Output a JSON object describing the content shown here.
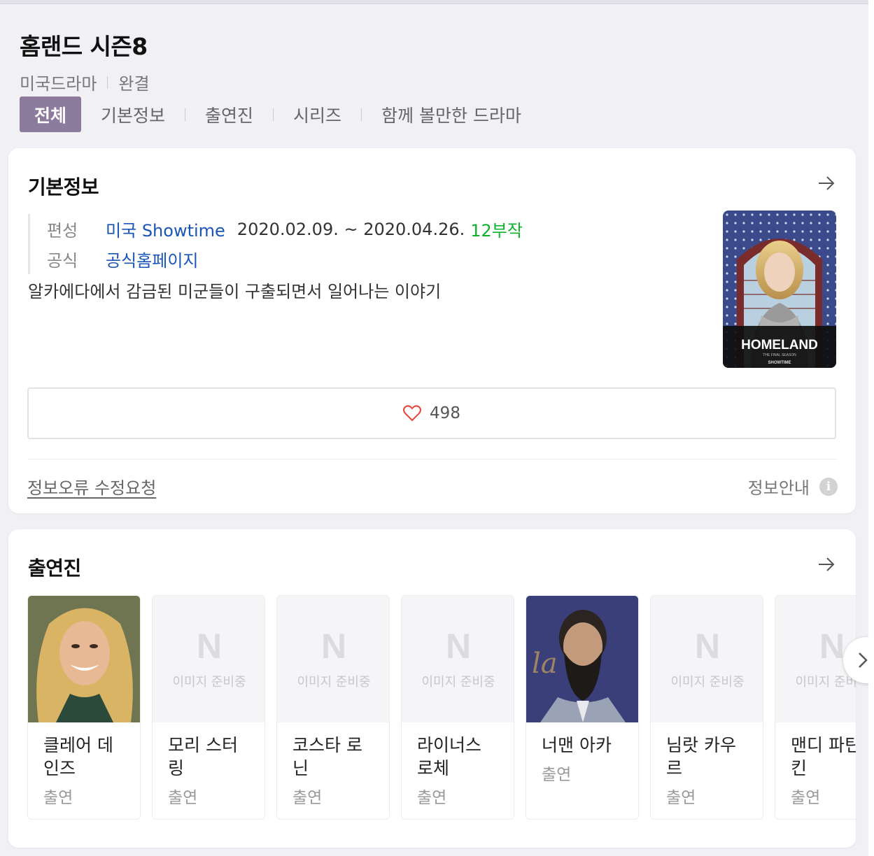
{
  "header": {
    "title": "홈랜드 시즌8",
    "genre": "미국드라마",
    "status": "완결"
  },
  "tabs": [
    {
      "label": "전체",
      "active": true
    },
    {
      "label": "기본정보"
    },
    {
      "label": "출연진"
    },
    {
      "label": "시리즈"
    },
    {
      "label": "함께 볼만한 드라마"
    }
  ],
  "basic_info": {
    "title": "기본정보",
    "broadcast_label": "편성",
    "country": "미국",
    "channel": "Showtime",
    "period": "2020.02.09. ~ 2020.04.26.",
    "episodes": "12부작",
    "official_label": "공식",
    "homepage": "공식홈페이지",
    "synopsis": "알카에다에서 감금된 미군들이 구출되면서 일어나는 이야기",
    "poster": {
      "logo": "HOMELAND",
      "tagline": "THE FINAL SEASON",
      "network": "SHOWTIME"
    },
    "like_count": "498",
    "report_link": "정보오류 수정요청",
    "info_guide": "정보안내"
  },
  "cast": {
    "title": "출연진",
    "placeholder_letter": "N",
    "placeholder_text": "이미지 준비중",
    "members": [
      {
        "name": "클레어 데인즈",
        "role": "출연"
      },
      {
        "name": "모리 스터링",
        "role": "출연"
      },
      {
        "name": "코스타 로닌",
        "role": "출연"
      },
      {
        "name": "라이너스 로체",
        "role": "출연"
      },
      {
        "name": "너맨 아카",
        "role": "출연"
      },
      {
        "name": "님랏 카우르",
        "role": "출연"
      },
      {
        "name": "맨디 파틴킨",
        "role": "출연"
      }
    ]
  },
  "colors": {
    "active_tab": "#8c7b9c",
    "link": "#1a56b8",
    "episodes": "#0fb12d",
    "heart": "#e8443a"
  }
}
